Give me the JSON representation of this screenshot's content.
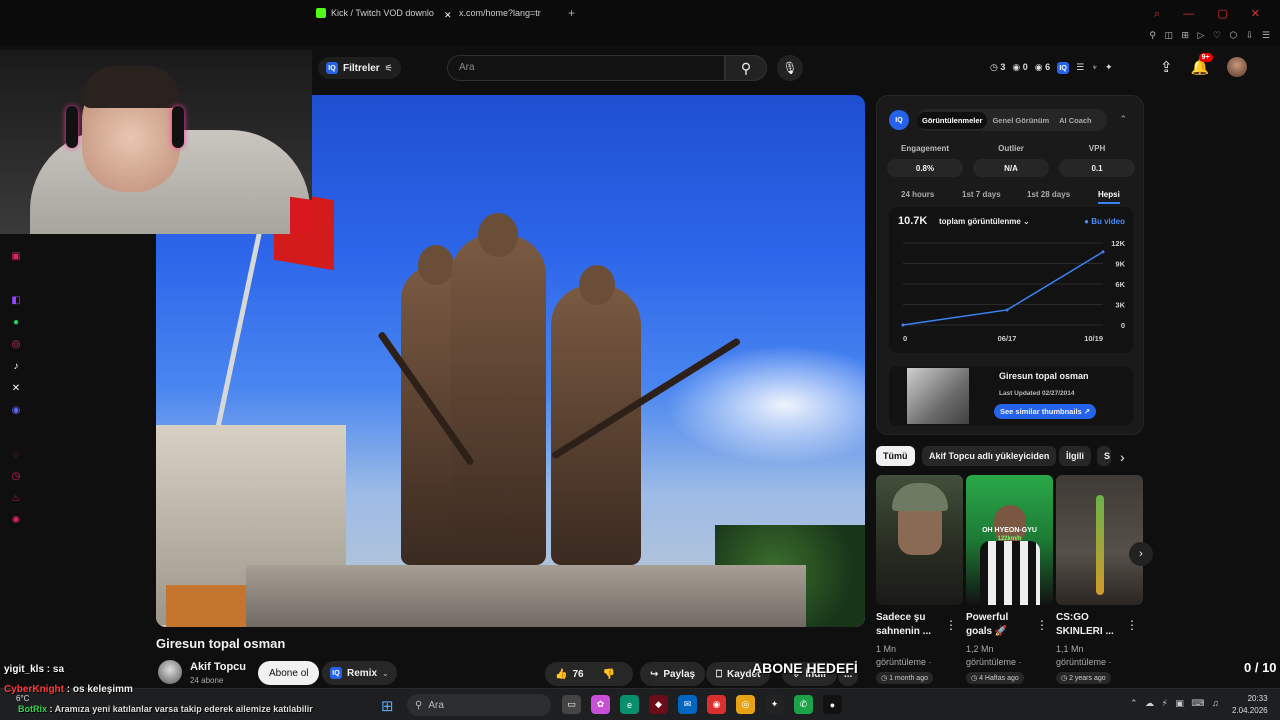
{
  "browser": {
    "tabs": [
      {
        "label": "Kick / Twitch VOD downlo",
        "favicon": "kick-icon",
        "color": "#53fc18"
      },
      {
        "label": "x.com/home?lang=tr",
        "favicon": "x-icon",
        "color": "#ffffff"
      }
    ],
    "new_tab": "+"
  },
  "header": {
    "filters_label": "Filtreler",
    "search_placeholder": "Ara",
    "stats": {
      "a": "3",
      "b": "0",
      "c": "6"
    },
    "notification_count": "9+"
  },
  "video": {
    "title": "Giresun topal osman",
    "channel": "Akif Topcu",
    "subscribers": "24 abone",
    "subscribe_label": "Abone ol",
    "remix_label": "Remix",
    "likes": "76",
    "share_label": "Paylaş",
    "save_label": "Kaydet",
    "download_label": "İndir",
    "more_label": "..."
  },
  "overlay": {
    "goal_text": "ABONE HEDEFİ",
    "goal_count": "0 / 10",
    "chat": [
      {
        "user": "yigit_kls",
        "msg": "sa",
        "color": "#ffffff"
      },
      {
        "user": "CyberKnight",
        "msg": "os keleşimm",
        "color": "#ff3b3b"
      },
      {
        "user": "BotRix",
        "msg": "Aramıza yeni katılanlar varsa takip ederek ailemize katılabilir",
        "color": "#39d353"
      }
    ]
  },
  "iq_panel": {
    "logo": "IQ",
    "tabs": [
      "Görüntülenmeler",
      "Genel Görünüm",
      "AI Coach"
    ],
    "active_tab": 0,
    "metrics": [
      {
        "label": "Engagement",
        "value": "0.8%"
      },
      {
        "label": "Outlier",
        "value": "N/A"
      },
      {
        "label": "VPH",
        "value": "0.1"
      }
    ],
    "ranges": [
      "24 hours",
      "1st 7 days",
      "1st 28 days",
      "Hepsi"
    ],
    "active_range": 3,
    "total": "10.7K",
    "metric_select": "toplam görüntülenme",
    "legend": "Bu video",
    "thumbnail_title": "Giresun topal osman",
    "last_updated": "Last Updated 02/27/2014",
    "similar_button": "See similar thumbnails ↗"
  },
  "chart_data": {
    "type": "line",
    "x": [
      "0",
      "06/17",
      "10/19"
    ],
    "series": [
      {
        "values": [
          0,
          2200,
          10700
        ]
      }
    ],
    "yticks": [
      "0",
      "3K",
      "6K",
      "9K",
      "12K"
    ],
    "ylim": [
      0,
      12000
    ],
    "grid": true,
    "color": "#3b82f6"
  },
  "related": {
    "chips": [
      "Tümü",
      "Akif Topcu adlı yükleyiciden",
      "İlgili",
      "S"
    ],
    "items": [
      {
        "title_line1": "Sadece şu",
        "title_line2": "sahnenin ...",
        "views": "1 Mn",
        "views_label": "görüntüleme ·",
        "date": "1 month ago"
      },
      {
        "title_line1": "Powerful",
        "title_line2": "goals 🚀",
        "views": "1,2 Mn",
        "views_label": "görüntüleme ·",
        "date": "4 Haftas ago",
        "thumb_text": "OH HYEON-GYU",
        "thumb_sub": "122km/h"
      },
      {
        "title_line1": "CS:GO",
        "title_line2": "SKINLERI ...",
        "views": "1,1 Mn",
        "views_label": "görüntüleme ·",
        "date": "2 years ago"
      }
    ]
  },
  "taskbar": {
    "weather": "6°C",
    "search_placeholder": "Ara",
    "time": "20:33",
    "date": "2.04.2026"
  }
}
